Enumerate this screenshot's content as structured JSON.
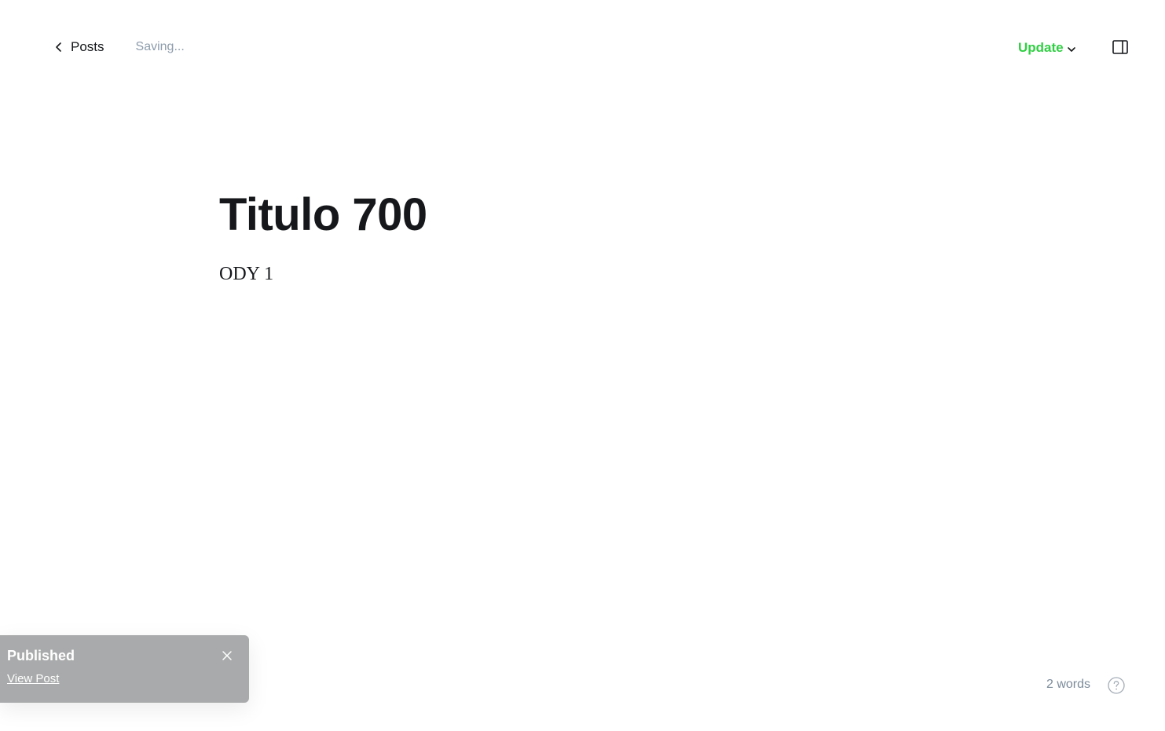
{
  "header": {
    "back_label": "Posts",
    "status_text": "Saving...",
    "update_label": "Update"
  },
  "editor": {
    "title": "Titulo 700",
    "body": "ODY 1"
  },
  "toast": {
    "title": "Published",
    "link_label": "View Post"
  },
  "footer": {
    "word_count": "2 words"
  },
  "colors": {
    "accent": "#30cf43",
    "toast_bg": "#a9aaab",
    "muted_text": "#8e9cac"
  },
  "icons": {
    "back": "chevron-left-icon",
    "update_caret": "chevron-down-icon",
    "sidebar": "sidebar-toggle-icon",
    "toast_close": "close-icon",
    "help": "question-circle-icon"
  }
}
